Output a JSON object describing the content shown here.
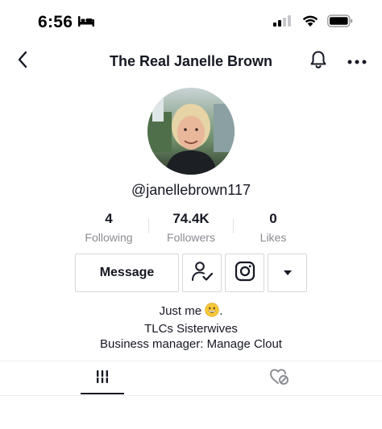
{
  "status_bar": {
    "time": "6:56",
    "icons": [
      "bed-icon",
      "signal-icon",
      "wifi-icon",
      "battery-icon"
    ]
  },
  "nav": {
    "title": "The Real Janelle Brown",
    "icons": [
      "back-chevron-icon",
      "bell-icon",
      "more-dots-icon"
    ]
  },
  "profile": {
    "username": "@janellebrown117"
  },
  "stats": [
    {
      "value": "4",
      "label": "Following"
    },
    {
      "value": "74.4K",
      "label": "Followers"
    },
    {
      "value": "0",
      "label": "Likes"
    }
  ],
  "actions": {
    "message_label": "Message",
    "icons": [
      "person-check-icon",
      "instagram-icon",
      "caret-down-icon"
    ]
  },
  "bio": {
    "line1": "Just me",
    "line1_suffix": ".",
    "line2": "TLCs Sisterwives",
    "line3": "Business manager: Manage Clout"
  },
  "tabs": {
    "items": [
      "videos-grid-icon",
      "liked-hidden-icon"
    ],
    "active": 0
  },
  "colors": {
    "text": "#161823",
    "muted": "#8a8b91",
    "border": "#d6d7da"
  }
}
